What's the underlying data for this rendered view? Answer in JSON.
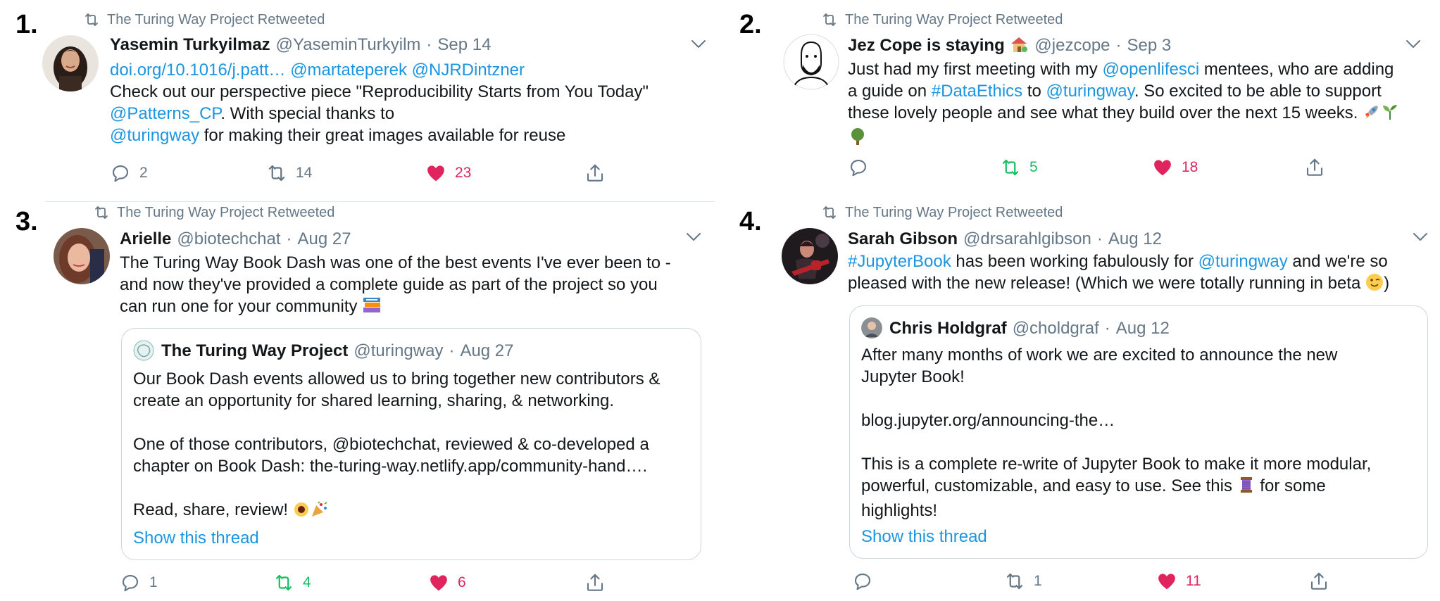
{
  "panels": [
    {
      "number": "1.",
      "retweet_label": "The Turing Way Project Retweeted",
      "name": "Yasemin Turkyilmaz",
      "handle": "@YaseminTurkyilm",
      "date": "Sep 14",
      "line_links": [
        "doi.org/10.1016/j.patt…",
        "@martateperek",
        "@NJRDintzner"
      ],
      "text_1": "Check out our perspective piece \"Reproducibility Starts from You Today\"",
      "mention_1": "@Patterns_CP",
      "text_2": ". With special thanks to",
      "mention_2": "@turingway",
      "text_3": " for making their great images available for reuse",
      "replies": "2",
      "retweets": "14",
      "likes": "23"
    },
    {
      "number": "2.",
      "retweet_label": "The Turing Way Project Retweeted",
      "name": "Jez Cope is staying",
      "handle": "@jezcope",
      "date": "Sep 3",
      "text_1": "Just had my first meeting with my ",
      "mention_1": "@openlifesci",
      "text_2": " mentees, who are adding",
      "text_3": "a guide on ",
      "hashtag_1": "#DataEthics",
      "text_4": " to ",
      "mention_2": "@turingway",
      "text_5": ". So excited to be able to support",
      "text_6": "these lovely people and see what they build over the next 15 weeks.",
      "replies": "",
      "retweets": "5",
      "likes": "18"
    },
    {
      "number": "3.",
      "retweet_label": "The Turing Way Project Retweeted",
      "name": "Arielle",
      "handle": "@biotechchat",
      "date": "Aug 27",
      "lines": [
        "The Turing Way Book Dash was one of the best events I've ever been to -",
        "and now they've provided a complete guide as part of the project so you",
        "can run one for your community"
      ],
      "quote": {
        "name": "The Turing Way Project",
        "handle": "@turingway",
        "date": "Aug 27",
        "lines": [
          "Our Book Dash events allowed us to bring together new contributors &",
          "create an opportunity for shared learning, sharing, & networking.",
          "",
          "One of those contributors, @biotechchat, reviewed & co-developed a",
          "chapter on Book Dash: the-turing-way.netlify.app/community-hand….",
          "",
          "Read, share, review!"
        ],
        "show_thread": "Show this thread"
      },
      "replies": "1",
      "retweets": "4",
      "likes": "6"
    },
    {
      "number": "4.",
      "retweet_label": "The Turing Way Project Retweeted",
      "name": "Sarah Gibson",
      "handle": "@drsarahlgibson",
      "date": "Aug 12",
      "hashtag_1": "#JupyterBook",
      "text_1": " has been working fabulously for ",
      "mention_1": "@turingway",
      "text_2": " and we're so",
      "text_3": "pleased with the new release! (Which we were totally running in beta ",
      "text_4": ")",
      "quote": {
        "name": "Chris Holdgraf",
        "handle": "@choldgraf",
        "date": "Aug 12",
        "lines": [
          "After many months of work we are excited to announce the new",
          "Jupyter Book!",
          "",
          "blog.jupyter.org/announcing-the…",
          "",
          "This is a complete re-write of Jupyter Book to make it more modular,",
          "powerful, customizable, and easy to use. See this",
          "highlights!"
        ],
        "line_7_suffix": " for some",
        "show_thread": "Show this thread"
      },
      "replies": "",
      "retweets": "1",
      "likes": "11"
    }
  ],
  "colors": {
    "link": "#1b95e0",
    "retweet_active": "#17bf63",
    "like_active": "#e0245e",
    "muted": "#657786"
  },
  "icons": [
    "retweet-icon",
    "reply-icon",
    "heart-icon",
    "share-icon",
    "caret-down-icon"
  ]
}
